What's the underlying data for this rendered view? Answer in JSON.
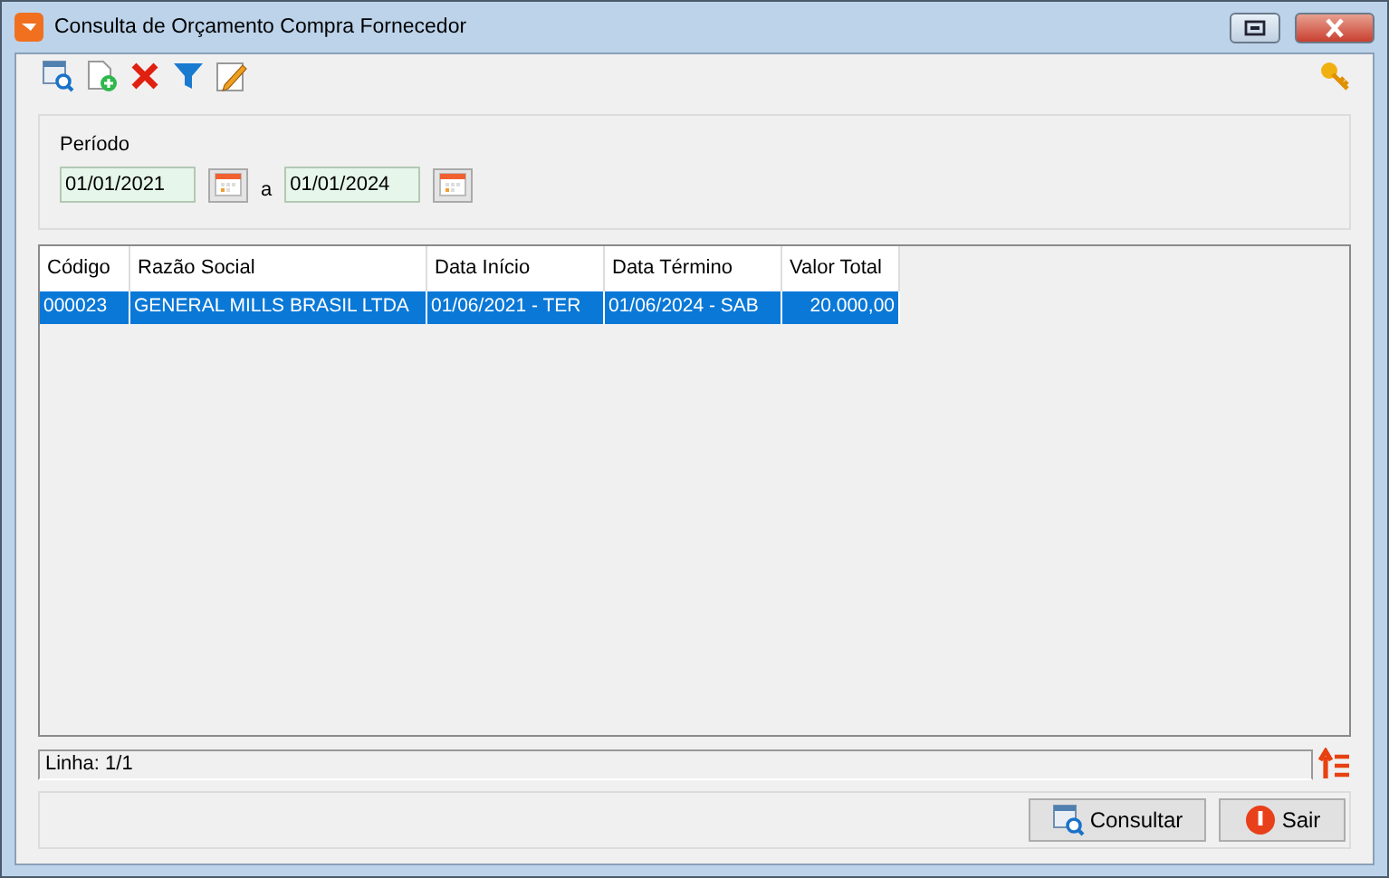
{
  "window": {
    "title": "Consulta de Orçamento Compra Fornecedor"
  },
  "period": {
    "label": "Período",
    "from": "01/01/2021",
    "separator": "a",
    "to": "01/01/2024"
  },
  "table": {
    "columns": [
      {
        "label": "Código",
        "kind": "text"
      },
      {
        "label": "Razão Social",
        "kind": "text"
      },
      {
        "label": "Data Início",
        "kind": "text"
      },
      {
        "label": "Data Término",
        "kind": "text"
      },
      {
        "label": "Valor Total",
        "kind": "amount"
      }
    ],
    "rows": [
      {
        "selected": true,
        "cells": [
          "000023",
          "GENERAL MILLS BRASIL LTDA",
          "01/06/2021 - TER",
          "01/06/2024 - SAB",
          "20.000,00"
        ]
      }
    ]
  },
  "status_bar": {
    "text": "Linha: 1/1"
  },
  "buttons": [
    {
      "kind": "search",
      "label": "Consultar"
    },
    {
      "kind": "exit",
      "label": "Sair"
    }
  ]
}
